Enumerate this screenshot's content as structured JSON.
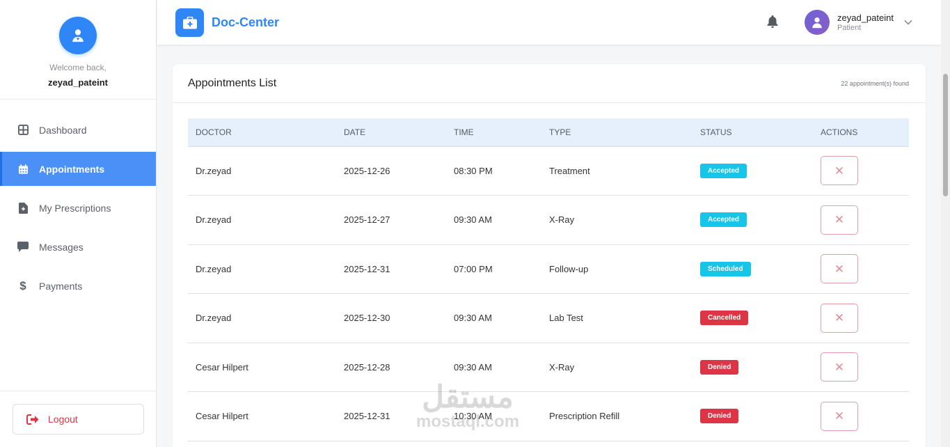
{
  "sidebar": {
    "welcome": "Welcome back,",
    "username": "zeyad_pateint",
    "items": [
      {
        "label": "Dashboard",
        "icon": "grid-icon",
        "active": false
      },
      {
        "label": "Appointments",
        "icon": "calendar-icon",
        "active": true
      },
      {
        "label": "My Prescriptions",
        "icon": "prescription-icon",
        "active": false
      },
      {
        "label": "Messages",
        "icon": "message-icon",
        "active": false
      },
      {
        "label": "Payments",
        "icon": "dollar-icon",
        "active": false
      }
    ],
    "logout_label": "Logout"
  },
  "header": {
    "brand": "Doc-Center",
    "user_name": "zeyad_pateint",
    "user_role": "Patient"
  },
  "card": {
    "title": "Appointments List",
    "count": "22 appointment(s) found"
  },
  "table": {
    "columns": [
      "DOCTOR",
      "DATE",
      "TIME",
      "TYPE",
      "STATUS",
      "ACTIONS"
    ],
    "rows": [
      {
        "doctor": "Dr.zeyad",
        "date": "2025-12-26",
        "time": "08:30 PM",
        "type": "Treatment",
        "status": "Accepted"
      },
      {
        "doctor": "Dr.zeyad",
        "date": "2025-12-27",
        "time": "09:30 AM",
        "type": "X-Ray",
        "status": "Accepted"
      },
      {
        "doctor": "Dr.zeyad",
        "date": "2025-12-31",
        "time": "07:00 PM",
        "type": "Follow-up",
        "status": "Scheduled"
      },
      {
        "doctor": "Dr.zeyad",
        "date": "2025-12-30",
        "time": "09:30 AM",
        "type": "Lab Test",
        "status": "Cancelled"
      },
      {
        "doctor": "Cesar Hilpert",
        "date": "2025-12-28",
        "time": "09:30 AM",
        "type": "X-Ray",
        "status": "Denied"
      },
      {
        "doctor": "Cesar Hilpert",
        "date": "2025-12-31",
        "time": "10:30 AM",
        "type": "Prescription Refill",
        "status": "Denied"
      }
    ],
    "action_glyph": "✕"
  },
  "status_colors": {
    "Accepted": "#17c5e8",
    "Scheduled": "#17c5e8",
    "Cancelled": "#dc3545",
    "Denied": "#dc3545"
  },
  "colors": {
    "accent": "#2f86f6",
    "sidebar_active": "#4a90f7",
    "danger": "#dc3545"
  },
  "watermark": {
    "arabic": "مستقل",
    "latin": "mostaql.com"
  }
}
